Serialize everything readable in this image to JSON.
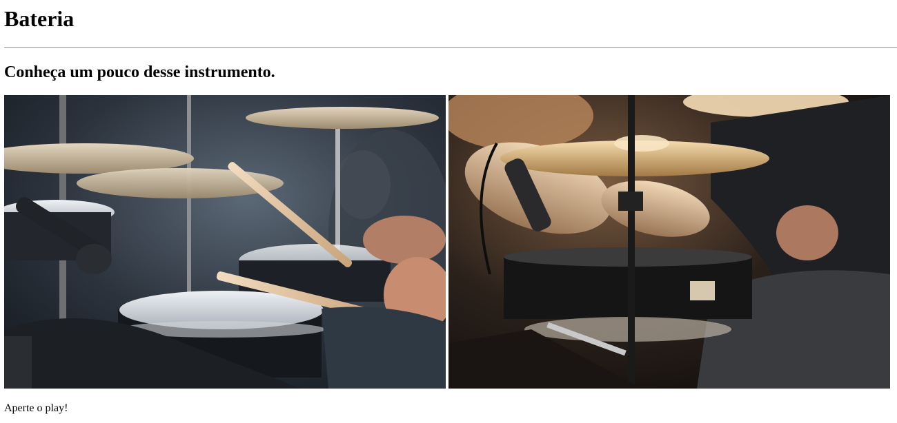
{
  "page": {
    "title": "Bateria",
    "subtitle": "Conheça um pouco desse instrumento.",
    "caption": "Aperte o play!"
  },
  "images": [
    {
      "name": "drum-photo-left",
      "icon": "drum-kit-photo"
    },
    {
      "name": "drum-photo-right",
      "icon": "drum-kit-photo"
    }
  ],
  "colors": {
    "text": "#000000",
    "rule": "#9a9a9a",
    "background": "#ffffff"
  }
}
